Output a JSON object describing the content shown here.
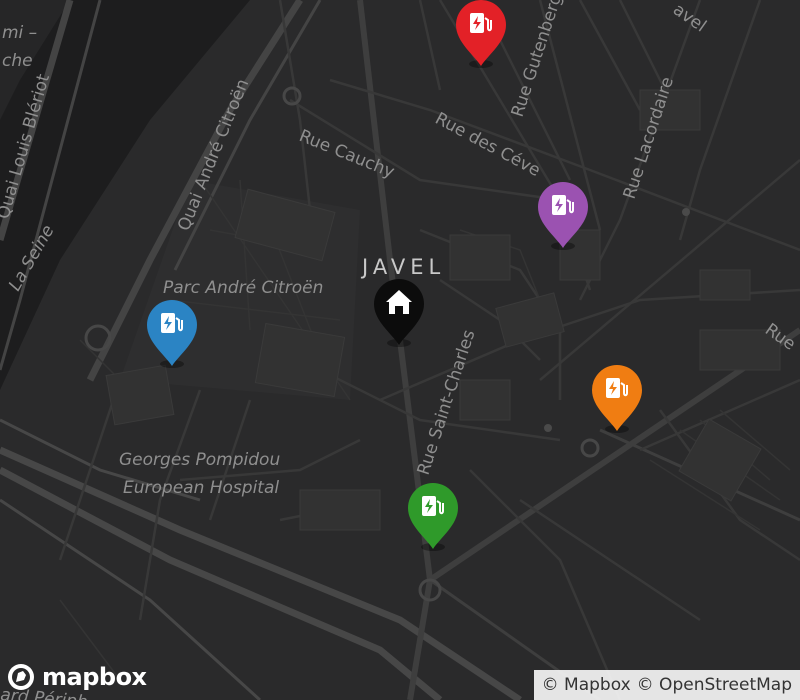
{
  "map": {
    "labels": {
      "quai_louis_bleriot": "Quai Louis Blériot",
      "la_seine": "La Seine",
      "quai_andre_citroen": "Quai André Citroën",
      "rue_cauchy": "Rue Cauchy",
      "rue_des_cevennes": "Rue des Céve",
      "rue_gutenberg": "Rue Gutenberg",
      "rue_lacordaire": "Rue Lacordaire",
      "javel_top": "avel",
      "district_javel": "JAVEL",
      "parc_andre_citroen": "Parc André Citroën",
      "rue_saint_charles": "Rue Saint-Charles",
      "hospital_line1": "Georges Pompidou",
      "hospital_line2": "European Hospital",
      "edge_top_left_1": "mi –",
      "edge_top_left_2": "che",
      "edge_right": "Rue",
      "edge_bottom": "ard Périph"
    },
    "markers": [
      {
        "id": "red",
        "icon": "ev-charging-station-icon",
        "color": "#e32127"
      },
      {
        "id": "purple",
        "icon": "ev-charging-station-icon",
        "color": "#9b52b1"
      },
      {
        "id": "home",
        "icon": "home-icon",
        "color": "#0c0c0c"
      },
      {
        "id": "blue",
        "icon": "ev-charging-station-icon",
        "color": "#2b84c4"
      },
      {
        "id": "orange",
        "icon": "ev-charging-station-icon",
        "color": "#f07d12"
      },
      {
        "id": "green",
        "icon": "ev-charging-station-icon",
        "color": "#2f9a2a"
      }
    ]
  },
  "logo": {
    "text": "mapbox"
  },
  "attribution": {
    "mapbox": "© Mapbox",
    "osm": "© OpenStreetMap"
  }
}
